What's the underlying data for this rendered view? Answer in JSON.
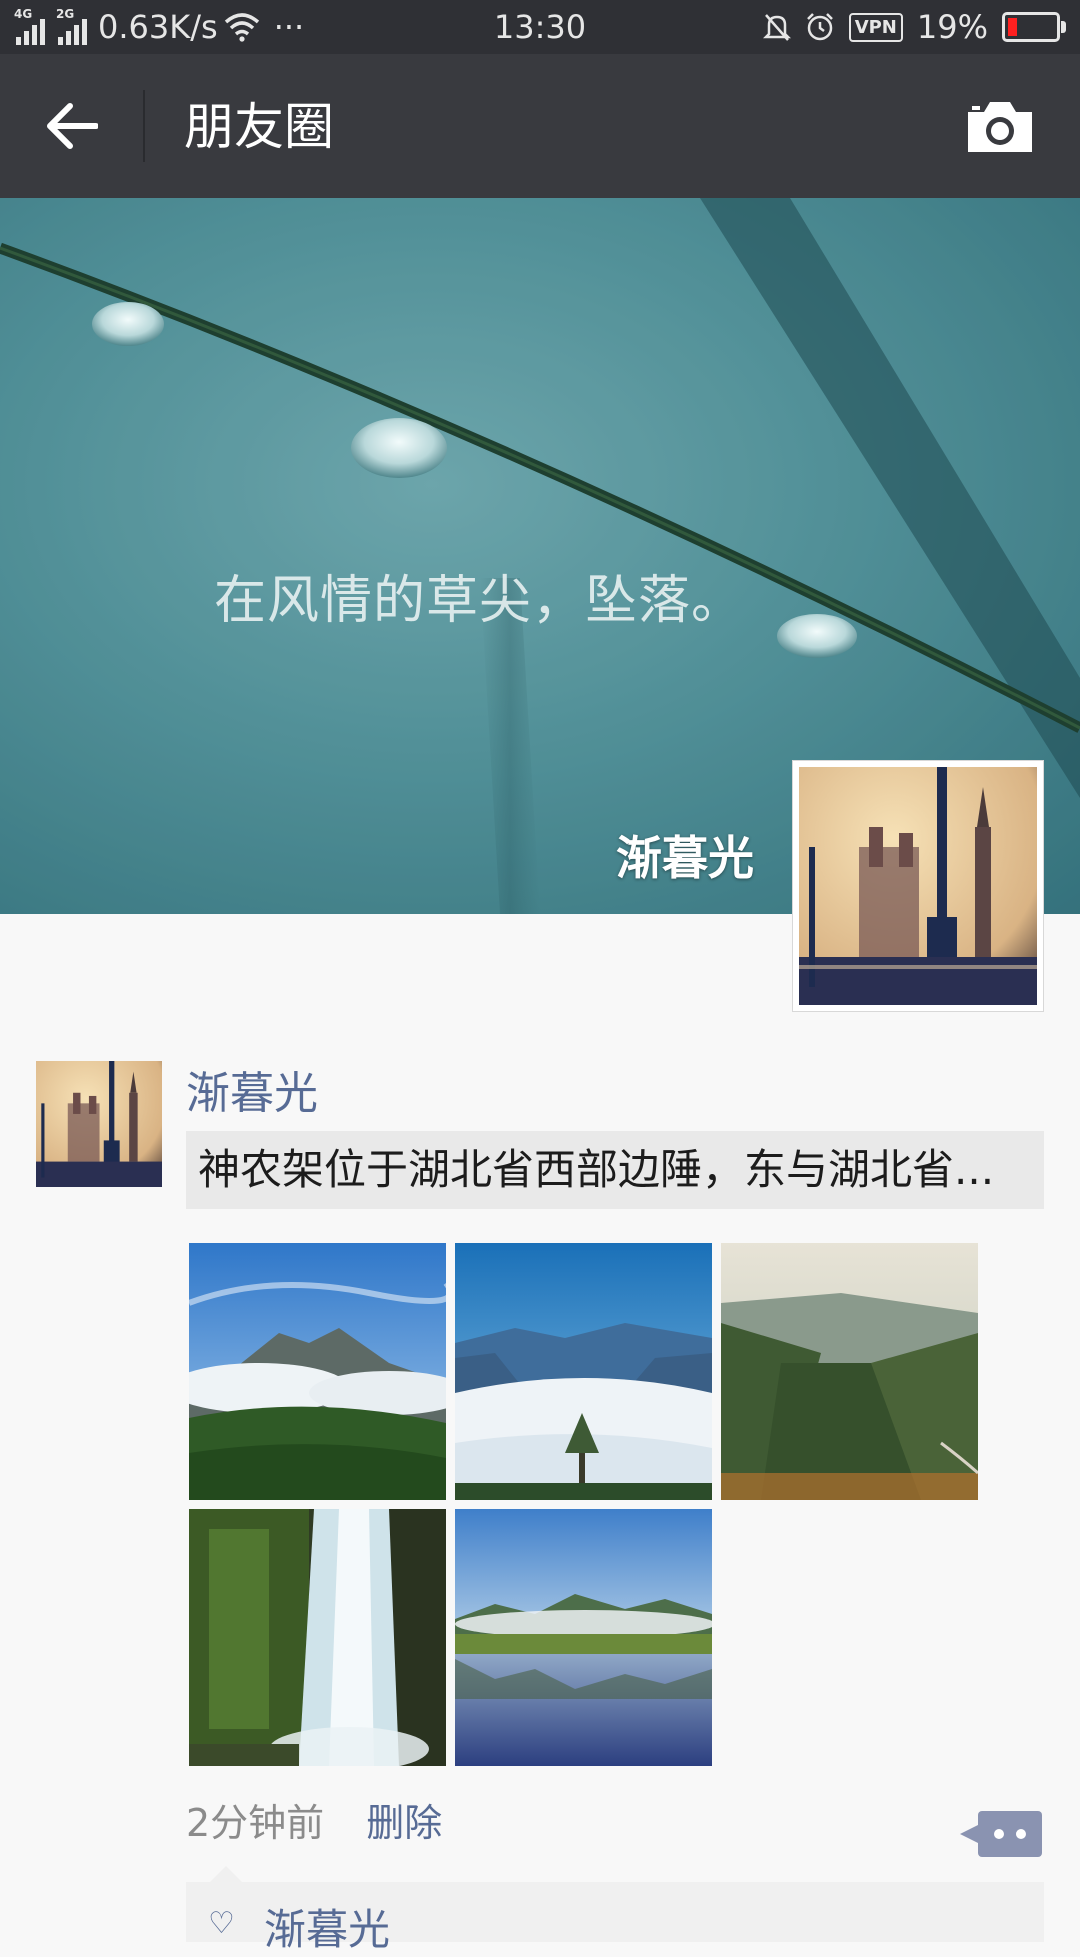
{
  "status_bar": {
    "sim1": "4G",
    "sim2": "2G",
    "net_speed": "0.63K/s",
    "more": "···",
    "time": "13:30",
    "vpn": "VPN",
    "battery": "19%",
    "battery_level": 0.19,
    "battery_color": "#ff2020"
  },
  "header": {
    "back_icon": "arrow-left-icon",
    "title": "朋友圈",
    "camera_icon": "camera-icon"
  },
  "cover": {
    "caption": "在风情的草尖，坠落。",
    "owner_name": "渐暮光"
  },
  "post": {
    "author": "渐暮光",
    "text": "神农架位于湖北省西部边陲，东与湖北省...",
    "photos": [
      "mountain-peak-clouds",
      "sea-of-clouds",
      "valley-forest",
      "waterfall",
      "lake-reflection"
    ],
    "time": "2分钟前",
    "delete_label": "删除",
    "likes": {
      "icon": "heart-icon",
      "names": "渐暮光"
    }
  },
  "colors": {
    "link": "#576b95",
    "titlebar": "#393a3f",
    "statusbar": "#2f3035"
  }
}
